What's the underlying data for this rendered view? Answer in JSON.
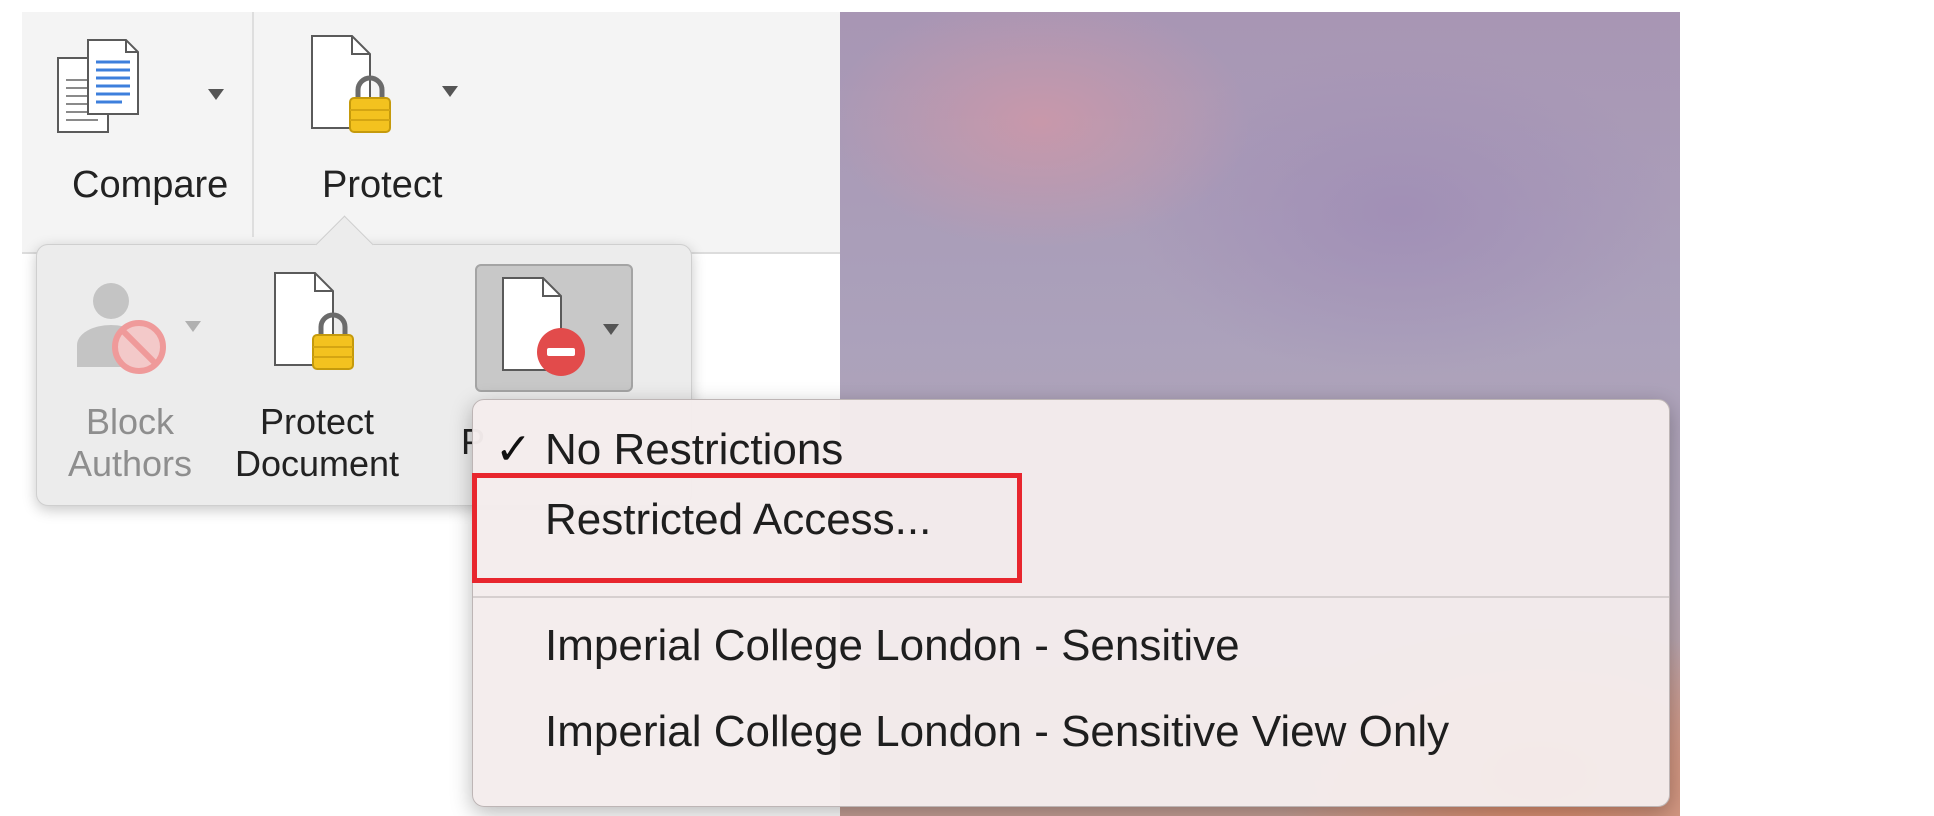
{
  "ribbon": {
    "compare_label": "Compare",
    "protect_label": "Protect"
  },
  "protect_gallery": {
    "block_authors_label_line1": "Block",
    "block_authors_label_line2": "Authors",
    "protect_document_label_line1": "Protect",
    "protect_document_label_line2": "Document",
    "restrict_permissions_label_partial": "P"
  },
  "permissions_menu": {
    "items": [
      {
        "label": "No Restrictions",
        "checked": true
      },
      {
        "label": "Restricted Access..."
      },
      {
        "label": "Imperial College London - Sensitive"
      },
      {
        "label": "Imperial College London - Sensitive View Only"
      }
    ],
    "check_glyph": "✓"
  },
  "colors": {
    "highlight": "#e8262e",
    "lock": "#f3c21f",
    "restrict_badge": "#e24b4b",
    "block_badge": "#f0a0a0"
  },
  "icons": [
    "compare-icon",
    "protect-lock-icon",
    "block-authors-icon",
    "protect-document-icon",
    "restrict-permissions-icon",
    "dropdown-caret-icon",
    "checkmark-icon"
  ]
}
